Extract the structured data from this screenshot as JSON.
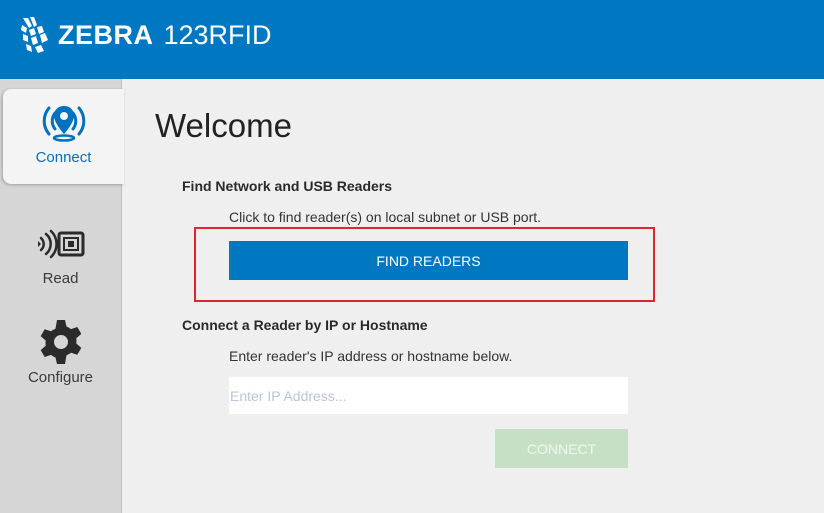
{
  "header": {
    "brand": "ZEBRA",
    "product": "123RFID",
    "logo_icon": "zebra-head-icon"
  },
  "sidebar": {
    "items": [
      {
        "label": "Connect",
        "icon": "location-signal-icon",
        "active": true
      },
      {
        "label": "Read",
        "icon": "rfid-tag-icon",
        "active": false
      },
      {
        "label": "Configure",
        "icon": "gear-icon",
        "active": false
      }
    ]
  },
  "main": {
    "title": "Welcome",
    "find_section": {
      "heading": "Find Network and USB Readers",
      "instruction": "Click to find reader(s) on local subnet or USB port.",
      "button_label": "FIND READERS"
    },
    "connect_section": {
      "heading": "Connect a Reader by IP or Hostname",
      "instruction": "Enter reader's IP address or hostname below.",
      "input_value": "",
      "input_placeholder": "Enter IP Address...",
      "button_label": "CONNECT"
    }
  },
  "colors": {
    "header_blue": "#0077c1",
    "highlight_red": "#e0262d",
    "connect_disabled": "#c6e0c6"
  }
}
